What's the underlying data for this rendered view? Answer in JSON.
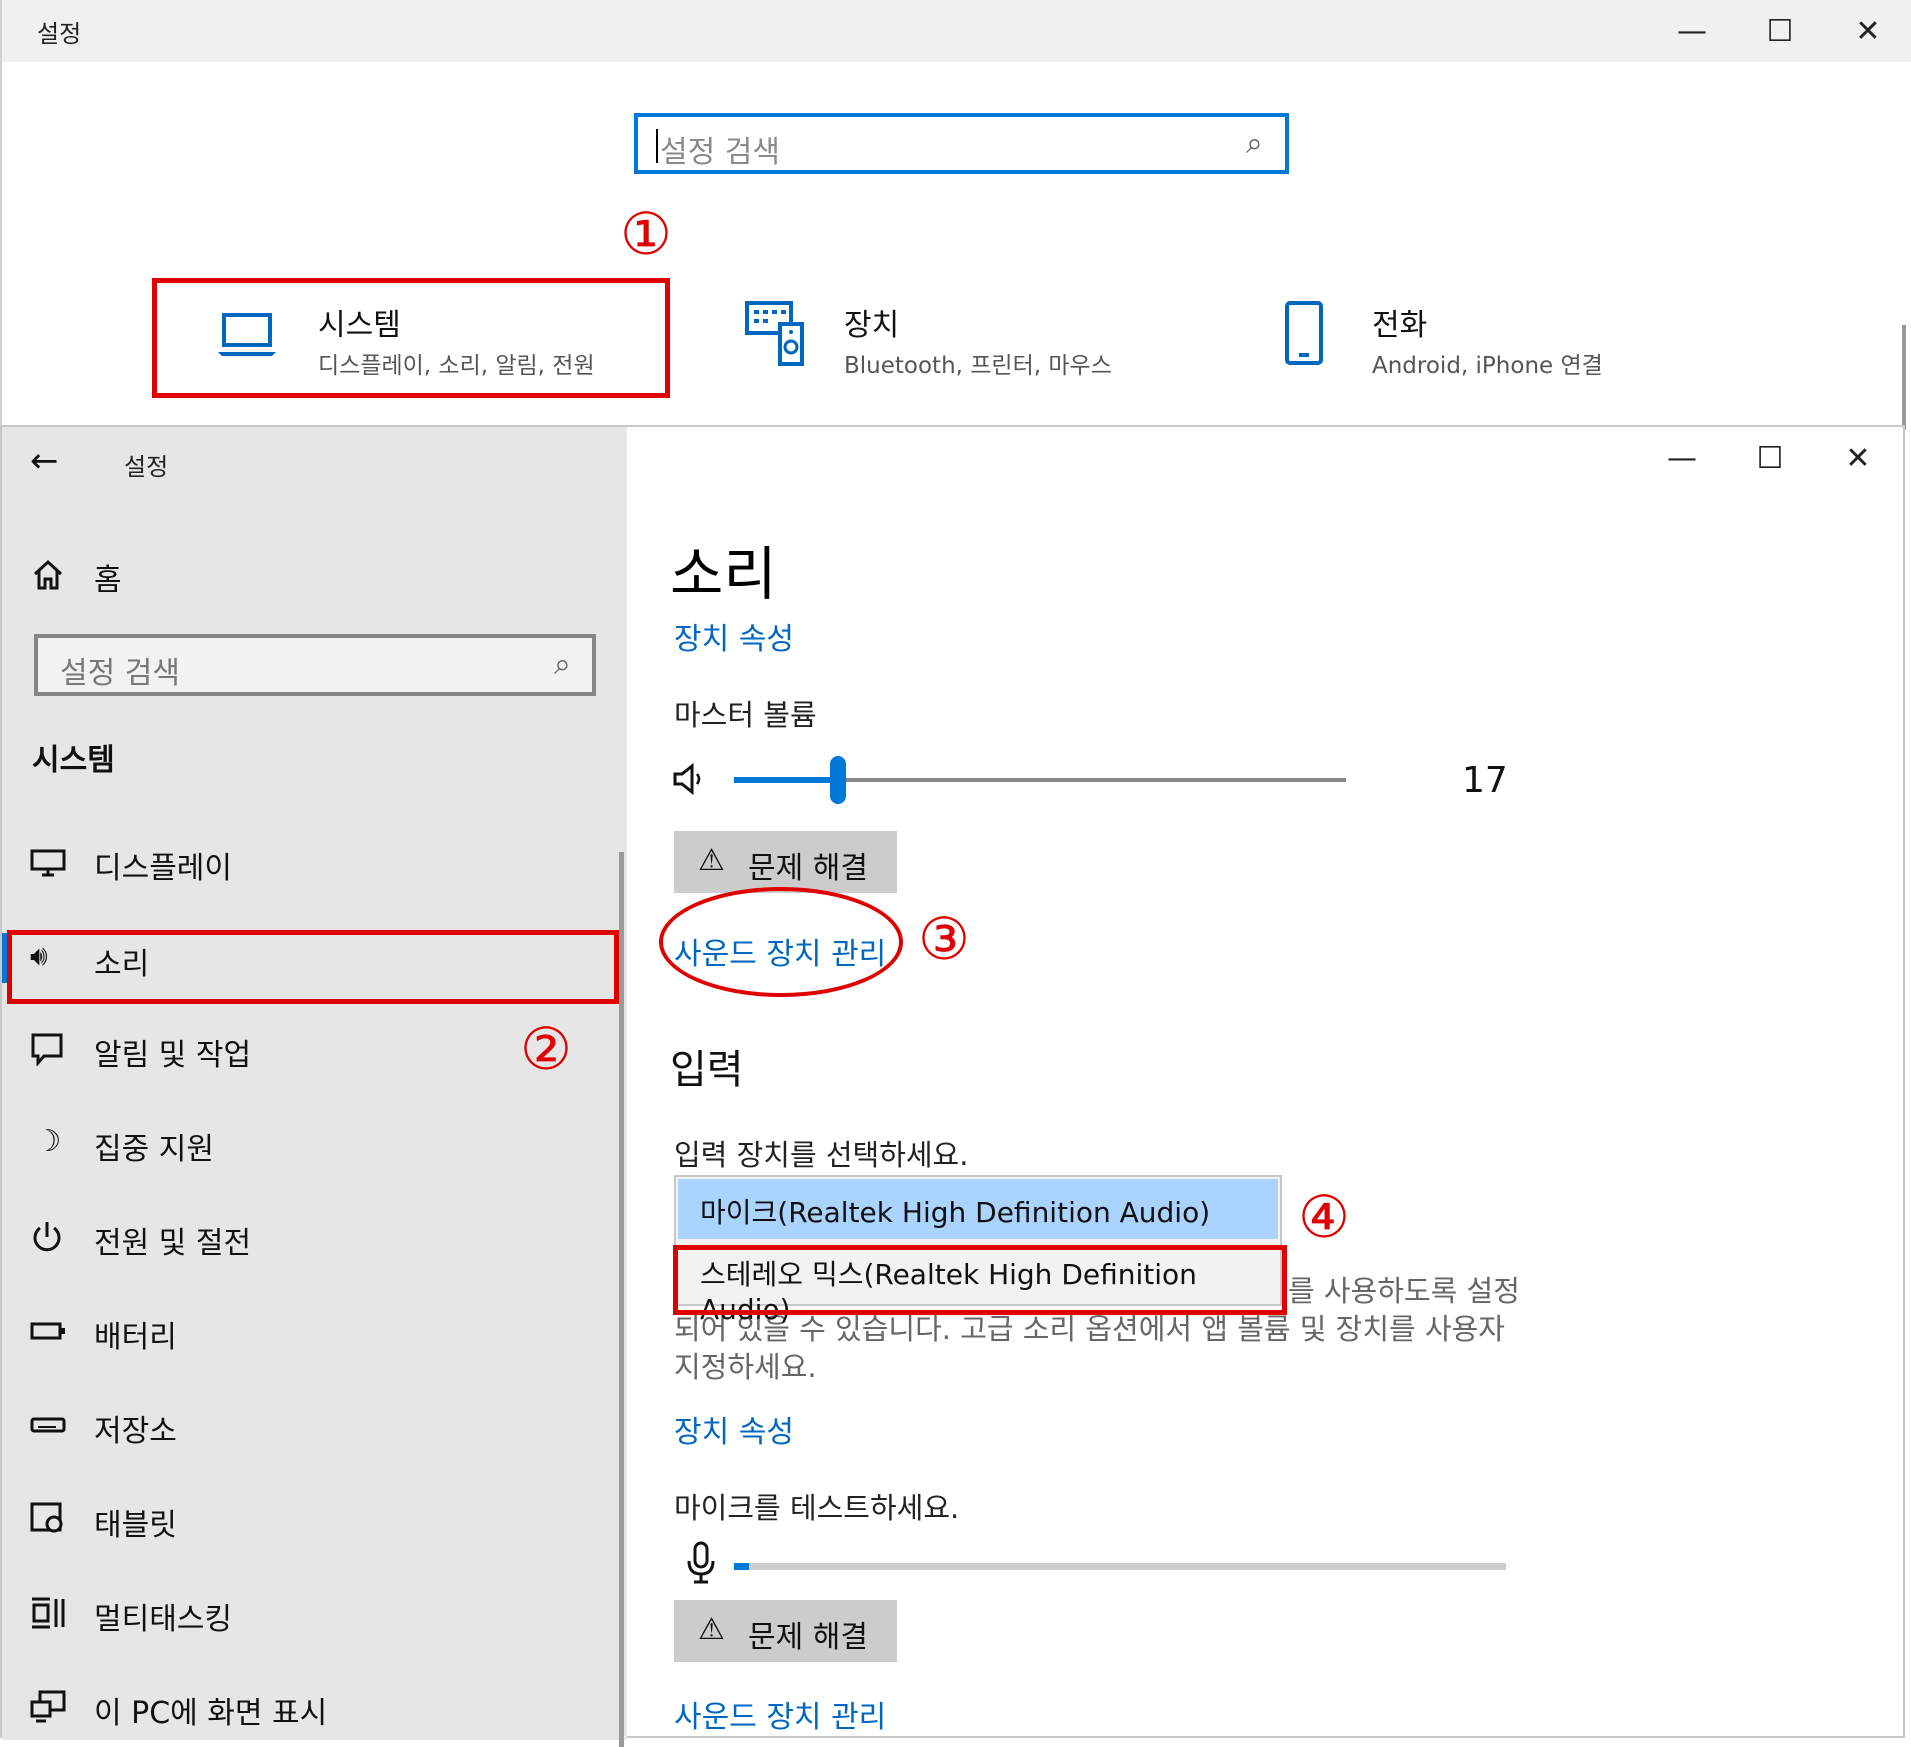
{
  "back_window": {
    "title": "설정",
    "controls": {
      "minimize": "—",
      "maximize": "☐",
      "close": "✕"
    },
    "search": {
      "placeholder": "설정 검색"
    },
    "annotation": "①",
    "tiles": [
      {
        "title": "시스템",
        "subtitle": "디스플레이, 소리, 알림, 전원",
        "icon": "laptop-icon"
      },
      {
        "title": "장치",
        "subtitle": "Bluetooth, 프린터, 마우스",
        "icon": "keyboard-speaker-icon"
      },
      {
        "title": "전화",
        "subtitle": "Android, iPhone 연결",
        "icon": "phone-icon"
      }
    ]
  },
  "front_window": {
    "title": "설정",
    "controls": {
      "minimize": "—",
      "maximize": "☐",
      "close": "✕"
    },
    "sidebar": {
      "home_label": "홈",
      "search": {
        "placeholder": "설정 검색"
      },
      "section_title": "시스템",
      "annotation": "②",
      "items": [
        {
          "label": "디스플레이",
          "icon": "monitor-icon"
        },
        {
          "label": "소리",
          "icon": "speaker-icon",
          "selected": true
        },
        {
          "label": "알림 및 작업",
          "icon": "notification-icon"
        },
        {
          "label": "집중 지원",
          "icon": "moon-icon"
        },
        {
          "label": "전원 및 절전",
          "icon": "power-icon"
        },
        {
          "label": "배터리",
          "icon": "battery-icon"
        },
        {
          "label": "저장소",
          "icon": "storage-icon"
        },
        {
          "label": "태블릿",
          "icon": "tablet-icon"
        },
        {
          "label": "멀티태스킹",
          "icon": "multitasking-icon"
        },
        {
          "label": "이 PC에 화면 표시",
          "icon": "project-icon"
        }
      ]
    },
    "content": {
      "page_title": "소리",
      "device_props_link": "장치 속성",
      "master_volume_label": "마스터 볼륨",
      "volume_value": "17",
      "volume_level": 0.17,
      "troubleshoot_label": "문제 해결",
      "manage_devices_link": "사운드 장치 관리",
      "annotation_3": "③",
      "input_heading": "입력",
      "choose_input_label": "입력 장치를 선택하세요.",
      "annotation_4": "④",
      "input_options": [
        "마이크(Realtek High Definition Audio)",
        "스테레오 믹스(Realtek High Definition Audio)"
      ],
      "selected_option_index": 0,
      "info_text_line1": "를 사용하도록 설정",
      "info_text_line2": "되어 있을 수 있습니다. 고급 소리 옵션에서 앱 볼륨 및 장치를 사용자",
      "info_text_line3": "지정하세요.",
      "device_props_link2": "장치 속성",
      "test_mic_label": "마이크를 테스트하세요.",
      "mic_level": 0.02,
      "troubleshoot_label2": "문제 해결",
      "manage_devices_link2": "사운드 장치 관리"
    },
    "colors": {
      "accent": "#0078d7",
      "annotation_red": "#e00000",
      "sidebar_bg": "#e6e6e6",
      "selected_option_bg": "#aad4ff"
    }
  }
}
